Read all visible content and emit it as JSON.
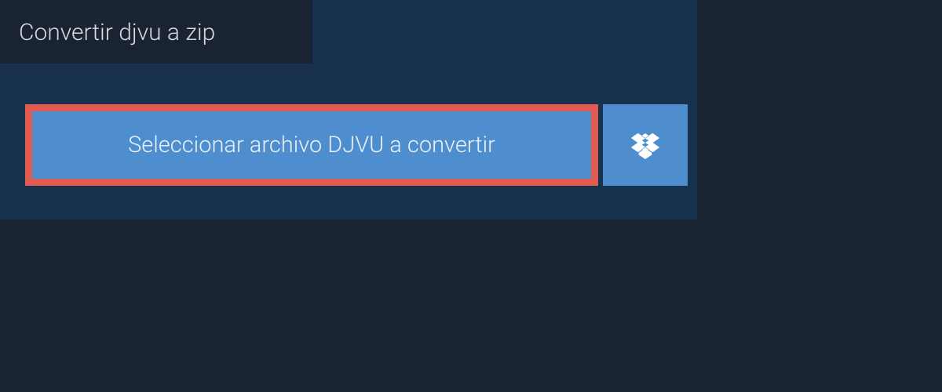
{
  "header": {
    "tab_label": "Convertir djvu a zip"
  },
  "upload": {
    "select_button_label": "Seleccionar archivo DJVU a convertir",
    "dropbox_icon": "dropbox"
  },
  "colors": {
    "background": "#1a2332",
    "panel": "#17314e",
    "button_primary": "#4e8ecf",
    "button_highlight_border": "#e35c52",
    "text_light": "#d5d9de"
  }
}
